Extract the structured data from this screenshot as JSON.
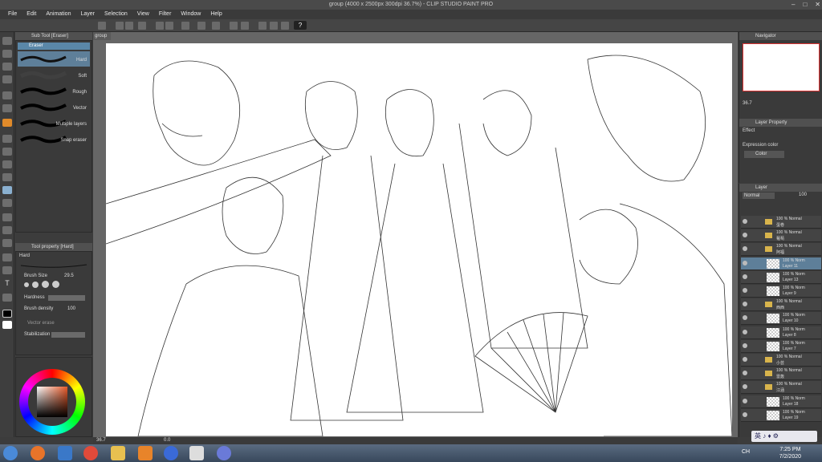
{
  "window": {
    "title": "group (4000 x 2500px 300dpi 36.7%)  - CLIP STUDIO PAINT PRO"
  },
  "menu": [
    "File",
    "Edit",
    "Animation",
    "Layer",
    "Selection",
    "View",
    "Filter",
    "Window",
    "Help"
  ],
  "subtool": {
    "header": "Sub Tool [Eraser]",
    "category": "Eraser",
    "brushes": [
      "Hard",
      "Soft",
      "Rough",
      "Vector",
      "Multiple layers",
      "Snap eraser"
    ],
    "selected": "Hard"
  },
  "toolprop": {
    "header": "Tool property [Hard]",
    "name": "Hard",
    "brush_size_label": "Brush Size",
    "brush_size_value": "29.5",
    "hardness_label": "Hardness",
    "brush_density_label": "Brush density",
    "brush_density_value": "100",
    "vector_erase_label": "Vector erase",
    "stabilization_label": "Stabilization"
  },
  "canvas": {
    "tab_label": "group",
    "zoom": "36.7",
    "rotation": "0.0"
  },
  "navigator": {
    "header": "Navigator",
    "zoom": "36.7"
  },
  "layer_property": {
    "header": "Layer Property",
    "effect_label": "Effect",
    "expression_color_label": "Expression color",
    "color_value": "Color"
  },
  "layer_panel": {
    "header": "Layer",
    "blend_mode": "Normal",
    "opacity": "100",
    "layers": [
      {
        "type": "folder",
        "line1": "100 % Normal",
        "line2": "蛋卷",
        "selected": false
      },
      {
        "type": "folder",
        "line1": "100 % Normal",
        "line2": "葡萄",
        "selected": false
      },
      {
        "type": "folder",
        "line1": "100 % Normal",
        "line2": "阿福",
        "selected": false
      },
      {
        "type": "layer",
        "line1": "100 % Norm",
        "line2": "Layer 11",
        "selected": true
      },
      {
        "type": "layer",
        "line1": "100 % Norm",
        "line2": "Layer 13",
        "selected": false
      },
      {
        "type": "layer",
        "line1": "100 % Norm",
        "line2": "Layer 9",
        "selected": false
      },
      {
        "type": "folder",
        "line1": "100 % Normal",
        "line2": "西西",
        "selected": false
      },
      {
        "type": "layer",
        "line1": "100 % Norm",
        "line2": "Layer 10",
        "selected": false
      },
      {
        "type": "layer",
        "line1": "100 % Norm",
        "line2": "Layer 8",
        "selected": false
      },
      {
        "type": "layer",
        "line1": "100 % Norm",
        "line2": "Layer 7",
        "selected": false
      },
      {
        "type": "folder",
        "line1": "100 % Normal",
        "line2": "小芸",
        "selected": false
      },
      {
        "type": "folder",
        "line1": "100 % Normal",
        "line2": "雷轰",
        "selected": false
      },
      {
        "type": "folder",
        "line1": "100 % Normal",
        "line2": "江涵",
        "selected": false
      },
      {
        "type": "layer",
        "line1": "100 % Norm",
        "line2": "Layer 18",
        "selected": false
      },
      {
        "type": "layer",
        "line1": "100 % Norm",
        "line2": "Layer 19",
        "selected": false
      }
    ]
  },
  "taskbar": {
    "ime_text": "英 ♪ ♦ ⚙",
    "lang": "CH",
    "time": "7:25 PM",
    "date": "7/2/2020"
  },
  "colors": {
    "accent": "#5e7f99",
    "panel_bg": "#3a3a3a"
  }
}
